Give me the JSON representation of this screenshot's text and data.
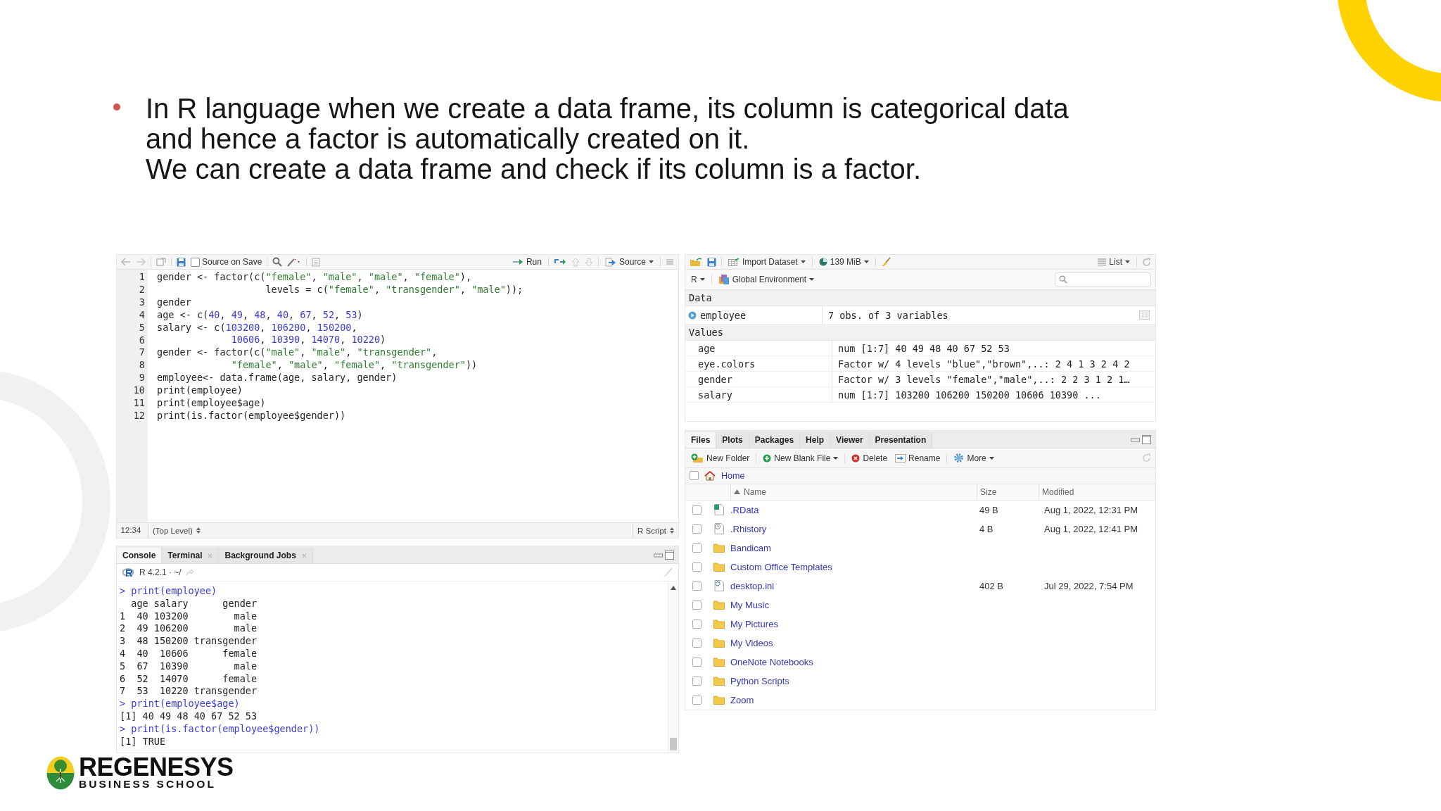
{
  "slide": {
    "bullets": [
      {
        "text": "In R language when we create a data frame, its column is categorical data and hence a factor is automatically created on it."
      }
    ],
    "note": "We can create a data frame and check if its column is a factor."
  },
  "editor": {
    "source_on_save": {
      "label": "Source on Save",
      "checked": false
    },
    "run": "Run",
    "source": "Source",
    "lines": [
      {
        "num": "1",
        "tokens": [
          {
            "kind": "code",
            "text": "gender <- factor(c("
          },
          {
            "kind": "string",
            "text": "\"female\""
          },
          {
            "kind": "code",
            "text": ", "
          },
          {
            "kind": "string",
            "text": "\"male\""
          },
          {
            "kind": "code",
            "text": ", "
          },
          {
            "kind": "string",
            "text": "\"male\""
          },
          {
            "kind": "code",
            "text": ", "
          },
          {
            "kind": "string",
            "text": "\"female\""
          },
          {
            "kind": "code",
            "text": "),"
          }
        ]
      },
      {
        "num": "2",
        "tokens": [
          {
            "kind": "code",
            "text": "                   levels = c("
          },
          {
            "kind": "string",
            "text": "\"female\""
          },
          {
            "kind": "code",
            "text": ", "
          },
          {
            "kind": "string",
            "text": "\"transgender\""
          },
          {
            "kind": "code",
            "text": ", "
          },
          {
            "kind": "string",
            "text": "\"male\""
          },
          {
            "kind": "code",
            "text": "));"
          }
        ]
      },
      {
        "num": "3",
        "tokens": [
          {
            "kind": "code",
            "text": "gender"
          }
        ]
      },
      {
        "num": "4",
        "tokens": [
          {
            "kind": "code",
            "text": "age <- c("
          },
          {
            "kind": "number",
            "text": "40"
          },
          {
            "kind": "code",
            "text": ", "
          },
          {
            "kind": "number",
            "text": "49"
          },
          {
            "kind": "code",
            "text": ", "
          },
          {
            "kind": "number",
            "text": "48"
          },
          {
            "kind": "code",
            "text": ", "
          },
          {
            "kind": "number",
            "text": "40"
          },
          {
            "kind": "code",
            "text": ", "
          },
          {
            "kind": "number",
            "text": "67"
          },
          {
            "kind": "code",
            "text": ", "
          },
          {
            "kind": "number",
            "text": "52"
          },
          {
            "kind": "code",
            "text": ", "
          },
          {
            "kind": "number",
            "text": "53"
          },
          {
            "kind": "code",
            "text": ")"
          }
        ]
      },
      {
        "num": "5",
        "tokens": [
          {
            "kind": "code",
            "text": "salary <- c("
          },
          {
            "kind": "number",
            "text": "103200"
          },
          {
            "kind": "code",
            "text": ", "
          },
          {
            "kind": "number",
            "text": "106200"
          },
          {
            "kind": "code",
            "text": ", "
          },
          {
            "kind": "number",
            "text": "150200"
          },
          {
            "kind": "code",
            "text": ","
          }
        ]
      },
      {
        "num": "6",
        "tokens": [
          {
            "kind": "number",
            "text": "             10606"
          },
          {
            "kind": "code",
            "text": ", "
          },
          {
            "kind": "number",
            "text": "10390"
          },
          {
            "kind": "code",
            "text": ", "
          },
          {
            "kind": "number",
            "text": "14070"
          },
          {
            "kind": "code",
            "text": ", "
          },
          {
            "kind": "number",
            "text": "10220"
          },
          {
            "kind": "code",
            "text": ")"
          }
        ]
      },
      {
        "num": "7",
        "tokens": [
          {
            "kind": "code",
            "text": "gender <- factor(c("
          },
          {
            "kind": "string",
            "text": "\"male\""
          },
          {
            "kind": "code",
            "text": ", "
          },
          {
            "kind": "string",
            "text": "\"male\""
          },
          {
            "kind": "code",
            "text": ", "
          },
          {
            "kind": "string",
            "text": "\"transgender\""
          },
          {
            "kind": "code",
            "text": ","
          }
        ]
      },
      {
        "num": "8",
        "tokens": [
          {
            "kind": "string",
            "text": "             \"female\""
          },
          {
            "kind": "code",
            "text": ", "
          },
          {
            "kind": "string",
            "text": "\"male\""
          },
          {
            "kind": "code",
            "text": ", "
          },
          {
            "kind": "string",
            "text": "\"female\""
          },
          {
            "kind": "code",
            "text": ", "
          },
          {
            "kind": "string",
            "text": "\"transgender\""
          },
          {
            "kind": "code",
            "text": "))"
          }
        ]
      },
      {
        "num": "9",
        "tokens": [
          {
            "kind": "code",
            "text": "employee<- data.frame(age, salary, gender)"
          }
        ]
      },
      {
        "num": "10",
        "tokens": [
          {
            "kind": "code",
            "text": "print(employee)"
          }
        ]
      },
      {
        "num": "11",
        "tokens": [
          {
            "kind": "code",
            "text": "print(employee$age)"
          }
        ]
      },
      {
        "num": "12",
        "tokens": [
          {
            "kind": "code",
            "text": "print(is.factor(employee$gender))"
          }
        ]
      }
    ],
    "status": {
      "position": "12:34",
      "scope": "(Top Level)",
      "file_type": "R Script"
    }
  },
  "console": {
    "tabs": [
      {
        "label": "Console",
        "selected": true,
        "closable": false
      },
      {
        "label": "Terminal",
        "selected": false,
        "closable": true
      },
      {
        "label": "Background Jobs",
        "selected": false,
        "closable": true
      }
    ],
    "version": "R 4.2.1 · ~/",
    "lines": [
      {
        "kind": "input",
        "text": "> print(employee)"
      },
      {
        "kind": "output",
        "text": "  age salary      gender"
      },
      {
        "kind": "output",
        "text": "1  40 103200        male"
      },
      {
        "kind": "output",
        "text": "2  49 106200        male"
      },
      {
        "kind": "output",
        "text": "3  48 150200 transgender"
      },
      {
        "kind": "output",
        "text": "4  40  10606      female"
      },
      {
        "kind": "output",
        "text": "5  67  10390        male"
      },
      {
        "kind": "output",
        "text": "6  52  14070      female"
      },
      {
        "kind": "output",
        "text": "7  53  10220 transgender"
      },
      {
        "kind": "input",
        "text": "> print(employee$age)"
      },
      {
        "kind": "output",
        "text": "[1] 40 49 48 40 67 52 53"
      },
      {
        "kind": "input",
        "text": "> print(is.factor(employee$gender))"
      },
      {
        "kind": "output",
        "text": "[1] TRUE"
      }
    ]
  },
  "environment": {
    "import": "Import Dataset",
    "memory": "139 MiB",
    "view": "List",
    "language": "R",
    "scope": "Global Environment",
    "sections": [
      {
        "title": "Data",
        "rows": [
          {
            "kind": "data",
            "name": "employee",
            "value": "7 obs. of 3 variables"
          }
        ]
      },
      {
        "title": "Values",
        "rows": [
          {
            "kind": "value",
            "name": "age",
            "value": "num [1:7] 40 49 48 40 67 52 53"
          },
          {
            "kind": "value",
            "name": "eye.colors",
            "value": "Factor w/ 4 levels \"blue\",\"brown\",..: 2 4 1 3 2 4 2"
          },
          {
            "kind": "value",
            "name": "gender",
            "value": "Factor w/ 3 levels \"female\",\"male\",..: 2 2 3 1 2 1…"
          },
          {
            "kind": "value",
            "name": "salary",
            "value": "num [1:7] 103200 106200 150200 10606 10390 ..."
          }
        ]
      }
    ]
  },
  "files": {
    "tabs": [
      {
        "label": "Files",
        "selected": true
      },
      {
        "label": "Plots",
        "selected": false
      },
      {
        "label": "Packages",
        "selected": false
      },
      {
        "label": "Help",
        "selected": false
      },
      {
        "label": "Viewer",
        "selected": false
      },
      {
        "label": "Presentation",
        "selected": false
      }
    ],
    "toolbar": {
      "new_folder": "New Folder",
      "new_file": "New Blank File",
      "delete": "Delete",
      "rename": "Rename",
      "more": "More"
    },
    "select_all": {
      "checked": false
    },
    "path": "Home",
    "columns": [
      "Name",
      "Size",
      "Modified"
    ],
    "rows": [
      {
        "kind": "data",
        "name": ".RData",
        "size": "49 B",
        "modified": "Aug 1, 2022, 12:31 PM",
        "checked": false
      },
      {
        "kind": "history",
        "name": ".Rhistory",
        "size": "4 B",
        "modified": "Aug 1, 2022, 12:41 PM",
        "checked": false
      },
      {
        "kind": "folder",
        "name": "Bandicam",
        "checked": false
      },
      {
        "kind": "folder",
        "name": "Custom Office Templates",
        "checked": false
      },
      {
        "kind": "settings",
        "name": "desktop.ini",
        "size": "402 B",
        "modified": "Jul 29, 2022, 7:54 PM",
        "checked": false
      },
      {
        "kind": "folder",
        "name": "My Music",
        "checked": false
      },
      {
        "kind": "folder",
        "name": "My Pictures",
        "checked": false
      },
      {
        "kind": "folder",
        "name": "My Videos",
        "checked": false
      },
      {
        "kind": "folder",
        "name": "OneNote Notebooks",
        "checked": false
      },
      {
        "kind": "folder",
        "name": "Python Scripts",
        "checked": false
      },
      {
        "kind": "folder",
        "name": "Zoom",
        "checked": false
      }
    ]
  },
  "logo": {
    "name": "REGENESYS",
    "subtitle": "BUSINESS SCHOOL"
  }
}
